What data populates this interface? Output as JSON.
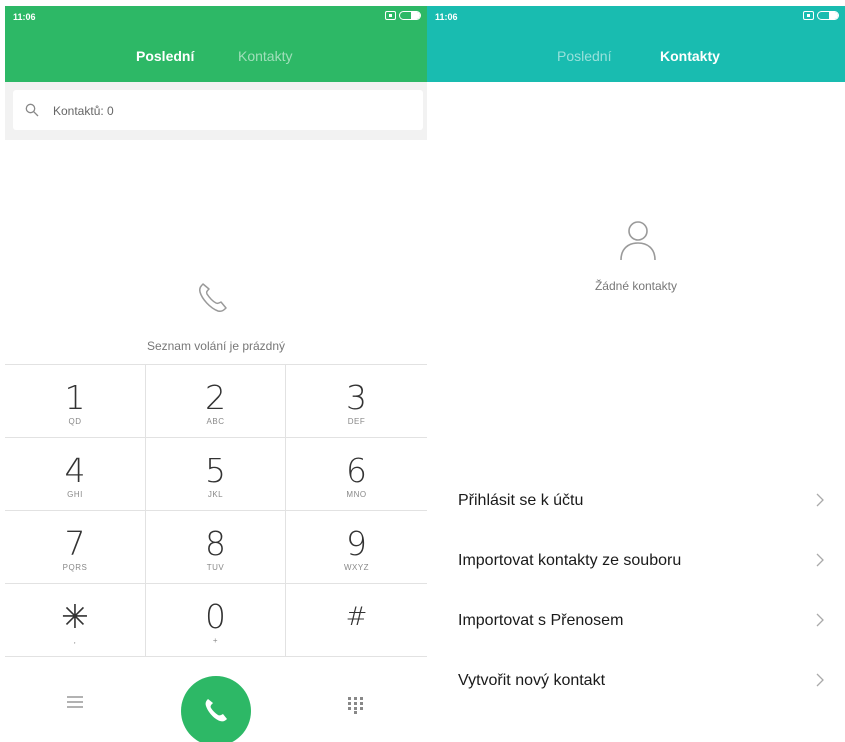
{
  "left_screen": {
    "status_time": "11:06",
    "tabs": [
      {
        "label": "Poslední",
        "active": true
      },
      {
        "label": "Kontakty",
        "active": false
      }
    ],
    "search": {
      "placeholder": "Kontaktů: 0"
    },
    "empty_message": "Seznam volání je prázdný",
    "keypad": [
      {
        "digit": "1",
        "letters": "QD"
      },
      {
        "digit": "2",
        "letters": "ABC"
      },
      {
        "digit": "3",
        "letters": "DEF"
      },
      {
        "digit": "4",
        "letters": "GHI"
      },
      {
        "digit": "5",
        "letters": "JKL"
      },
      {
        "digit": "6",
        "letters": "MNO"
      },
      {
        "digit": "7",
        "letters": "PQRS"
      },
      {
        "digit": "8",
        "letters": "TUV"
      },
      {
        "digit": "9",
        "letters": "WXYZ"
      },
      {
        "digit": "✳",
        "letters": ","
      },
      {
        "digit": "0",
        "letters": "+"
      },
      {
        "digit": "#",
        "letters": ""
      }
    ],
    "accent_color": "#2db866",
    "icons": [
      "search-icon",
      "phone-icon",
      "menu-icon",
      "call-icon",
      "dialpad-icon"
    ]
  },
  "right_screen": {
    "status_time": "11:06",
    "tabs": [
      {
        "label": "Poslední",
        "active": false
      },
      {
        "label": "Kontakty",
        "active": true
      }
    ],
    "empty_message": "Žádné kontakty",
    "actions": [
      {
        "label": "Přihlásit se k účtu"
      },
      {
        "label": "Importovat kontakty ze souboru"
      },
      {
        "label": "Importovat s Přenosem"
      },
      {
        "label": "Vytvořit nový kontakt"
      }
    ],
    "accent_color": "#19bcb0",
    "icons": [
      "person-icon",
      "chevron-right-icon"
    ]
  },
  "battery_level": 0.45
}
